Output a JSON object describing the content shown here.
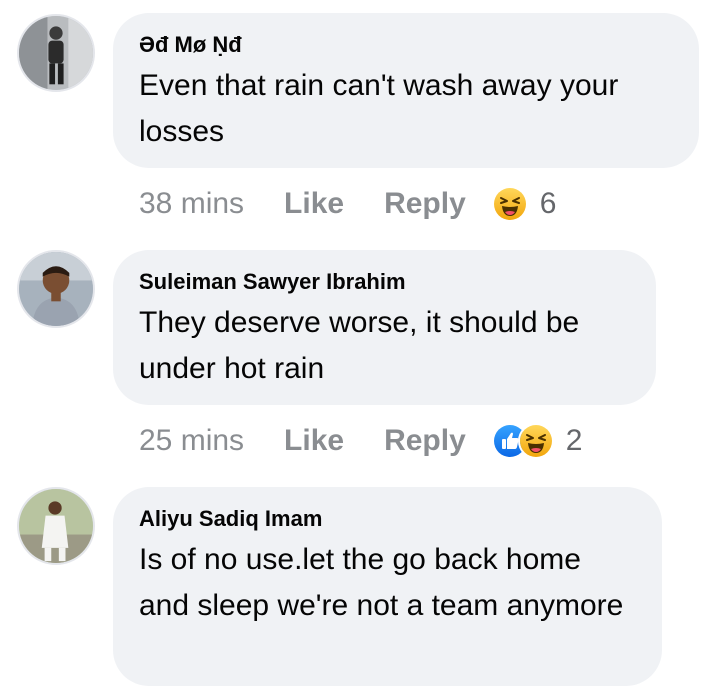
{
  "comments": [
    {
      "author": "Əđ Mø Ṇđ",
      "text": "Even that rain can't wash away your losses",
      "time": "38 mins",
      "like_label": "Like",
      "reply_label": "Reply",
      "reactions": [
        "haha"
      ],
      "reaction_count": "6",
      "avatar_icon": "profile-photo"
    },
    {
      "author": "Suleiman Sawyer Ibrahim",
      "text": "They deserve worse, it should be under hot rain",
      "time": "25 mins",
      "like_label": "Like",
      "reply_label": "Reply",
      "reactions": [
        "like",
        "haha"
      ],
      "reaction_count": "2",
      "avatar_icon": "profile-photo"
    },
    {
      "author": "Aliyu Sadiq Imam",
      "text": "Is of no use.let the go back home and sleep we're not a team anymore",
      "avatar_icon": "profile-photo"
    }
  ],
  "colors": {
    "bubble": "#f0f2f5",
    "meta_text": "#8a8d91",
    "like_blue": "#1877f2",
    "haha_yellow": "#f7b125"
  }
}
